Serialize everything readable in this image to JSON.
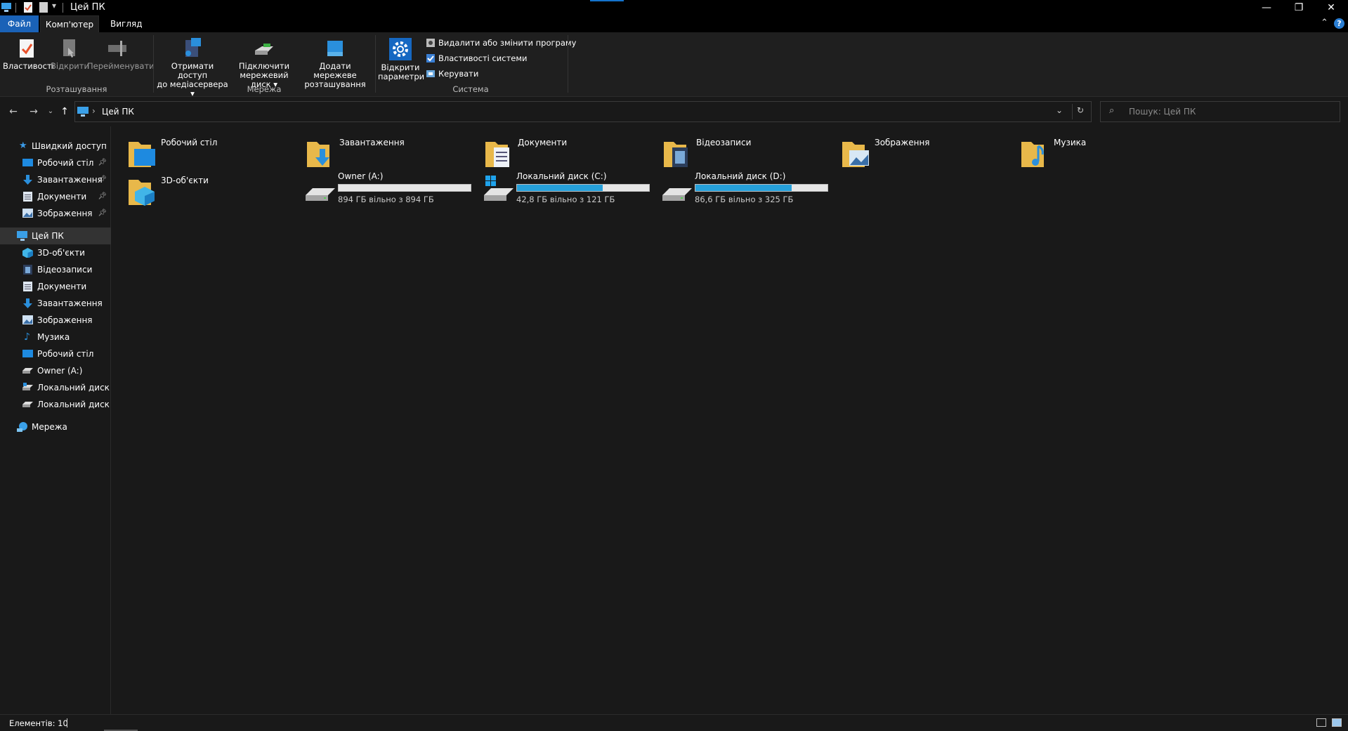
{
  "window": {
    "title": "Цей ПК"
  },
  "ribbon": {
    "tabs": [
      "Файл",
      "Комп'ютер",
      "Вигляд"
    ],
    "groups": {
      "location": {
        "label": "Розташування",
        "buttons": [
          "Властивості",
          "Відкрити",
          "Перейменувати"
        ]
      },
      "network": {
        "label": "Мережа",
        "buttons": [
          {
            "line1": "Отримати доступ",
            "line2": "до медіасервера"
          },
          {
            "line1": "Підключити",
            "line2": "мережевий диск"
          },
          {
            "line1": "Додати мережеве",
            "line2": "розташування"
          }
        ]
      },
      "system": {
        "label": "Система",
        "open_settings": {
          "line1": "Відкрити",
          "line2": "параметри"
        },
        "commands": [
          "Видалити або змінити програму",
          "Властивості системи",
          "Керувати"
        ]
      }
    }
  },
  "address": {
    "path": "Цей ПК",
    "search_placeholder": "Пошук: Цей ПК"
  },
  "navpane": {
    "quick_access": "Швидкий доступ",
    "quick_items": [
      "Робочий стіл",
      "Завантаження",
      "Документи",
      "Зображення"
    ],
    "this_pc": "Цей ПК",
    "pc_items": [
      "3D-об'єкти",
      "Відеозаписи",
      "Документи",
      "Завантаження",
      "Зображення",
      "Музика",
      "Робочий стіл",
      "Owner (A:)",
      "Локальний диск (C",
      "Локальний диск (D"
    ],
    "network": "Мережа"
  },
  "folders": [
    "Робочий стіл",
    "Завантаження",
    "Документи",
    "Відеозаписи",
    "Зображення",
    "Музика",
    "3D-об'єкти"
  ],
  "drives": [
    {
      "name": "Owner (A:)",
      "free": "894 ГБ вільно з 894 ГБ",
      "used_fraction": 0.0
    },
    {
      "name": "Локальний диск (C:)",
      "free": "42,8 ГБ вільно з 121 ГБ",
      "used_fraction": 0.65
    },
    {
      "name": "Локальний диск (D:)",
      "free": "86,6 ГБ вільно з 325 ГБ",
      "used_fraction": 0.73
    }
  ],
  "status": {
    "items": "Елементів: 10"
  },
  "colors": {
    "accent": "#1a62b7",
    "bar_fill": "#26a0da",
    "folder": "#f0c860"
  }
}
